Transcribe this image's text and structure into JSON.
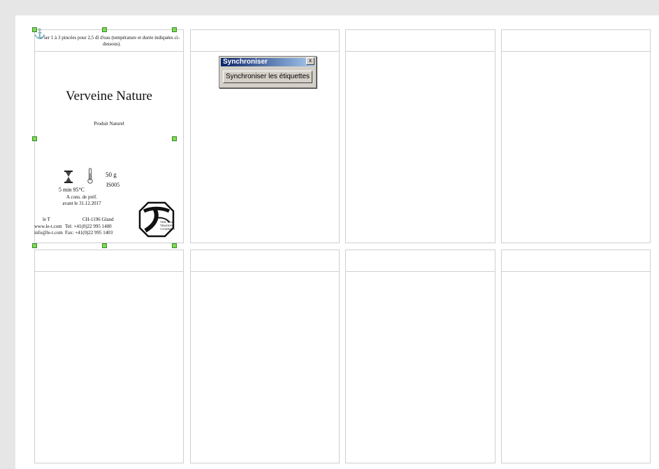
{
  "label": {
    "instructions": "ser 1 à 3 pincées pour 2,5 dl d'eau (température et durée indiquées ci-dessous).",
    "product_name": "Verveine Nature",
    "subtitle": "Produit Naturel",
    "weight": "50 g",
    "iso": "IS005",
    "time_temp": "5 min   95°C",
    "best_before_line1": "A cons. de préf.",
    "best_before_line2": "avant le 31.12.2017",
    "company": "le T",
    "city": "CH-1196 Gland",
    "website": "www.le-t.com",
    "phone": "Tel: +41(0)22 995 1400",
    "email": "info@le-t.com",
    "fax": "Fax: +41(0)22 995 1403",
    "logo_text": "THE TEA TRADING COMPANY"
  },
  "dialog": {
    "title": "Synchroniser",
    "close_label": "x",
    "button_label": "Synchroniser les étiquettes"
  },
  "icons": {
    "anchor": "anchor-icon",
    "hourglass": "hourglass-icon",
    "thermometer": "thermometer-icon"
  },
  "colors": {
    "handle": "#7ed957",
    "title_bar_start": "#0a246a",
    "title_bar_end": "#a6caf0"
  }
}
